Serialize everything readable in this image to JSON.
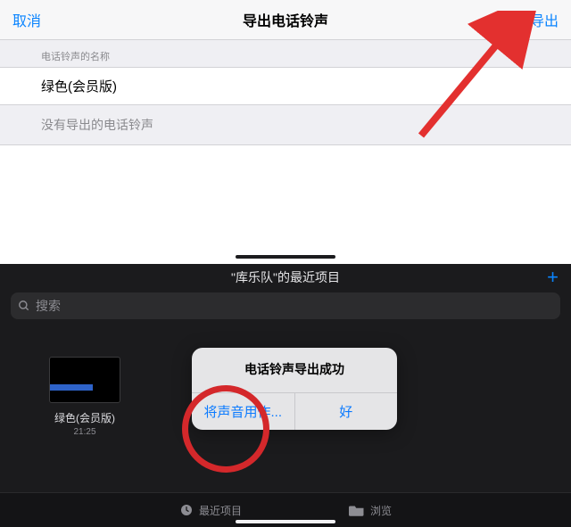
{
  "top": {
    "cancel": "取消",
    "title": "导出电话铃声",
    "export": "导出",
    "name_caption": "电话铃声的名称",
    "ringtone_name": "绿色(会员版)",
    "no_exported": "没有导出的电话铃声"
  },
  "bottom": {
    "header": "\"库乐队\"的最近项目",
    "plus": "+",
    "search_placeholder": "搜索",
    "project": {
      "name": "绿色(会员版)",
      "time": "21:25"
    },
    "alert": {
      "title": "电话铃声导出成功",
      "use_sound": "将声音用作...",
      "ok": "好"
    },
    "tabs": {
      "recent": "最近项目",
      "browse": "浏览"
    }
  }
}
